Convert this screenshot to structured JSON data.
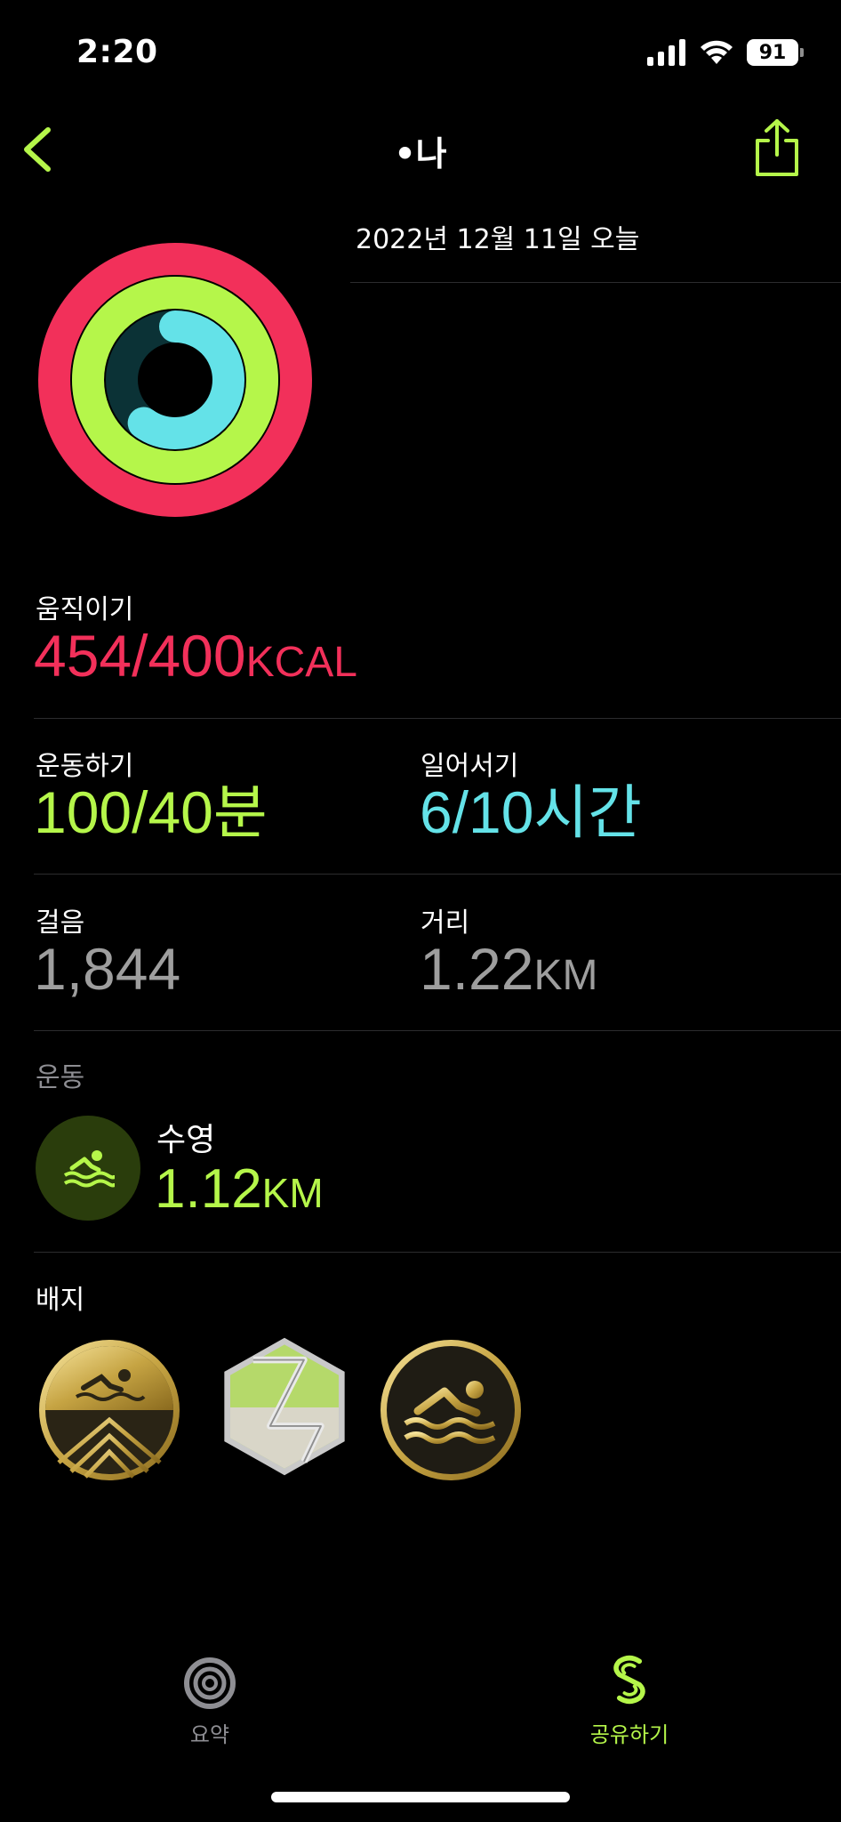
{
  "status_bar": {
    "time": "2:20",
    "battery": "91"
  },
  "nav": {
    "title": "•나",
    "back_icon": "chevron-left-icon",
    "share_icon": "share-icon"
  },
  "date": "2022년 12월 11일 오늘",
  "rings": {
    "move_progress": 1.135,
    "exercise_progress": 2.5,
    "stand_progress": 0.6,
    "colors": {
      "move": "#f2305a",
      "exercise": "#b5f64a",
      "stand": "#64e2e8"
    }
  },
  "move": {
    "label": "움직이기",
    "value": "454/400",
    "unit": "KCAL"
  },
  "exercise": {
    "label": "운동하기",
    "value": "100/40분"
  },
  "stand": {
    "label": "일어서기",
    "value": "6/10시간"
  },
  "steps": {
    "label": "걸음",
    "value": "1,844"
  },
  "distance": {
    "label": "거리",
    "value": "1.22",
    "unit": "KM"
  },
  "workouts": {
    "label": "운동",
    "items": [
      {
        "name": "수영",
        "value": "1.12",
        "unit": "KM",
        "icon": "swimming-icon"
      }
    ]
  },
  "badges": {
    "label": "배지",
    "items": [
      {
        "icon": "swim-mountain-badge-icon"
      },
      {
        "icon": "hexagon-badge-icon"
      },
      {
        "icon": "swimming-badge-icon"
      }
    ]
  },
  "tabs": [
    {
      "label": "요약",
      "icon": "rings-icon",
      "active": false
    },
    {
      "label": "공유하기",
      "icon": "sharing-icon",
      "active": true
    }
  ]
}
